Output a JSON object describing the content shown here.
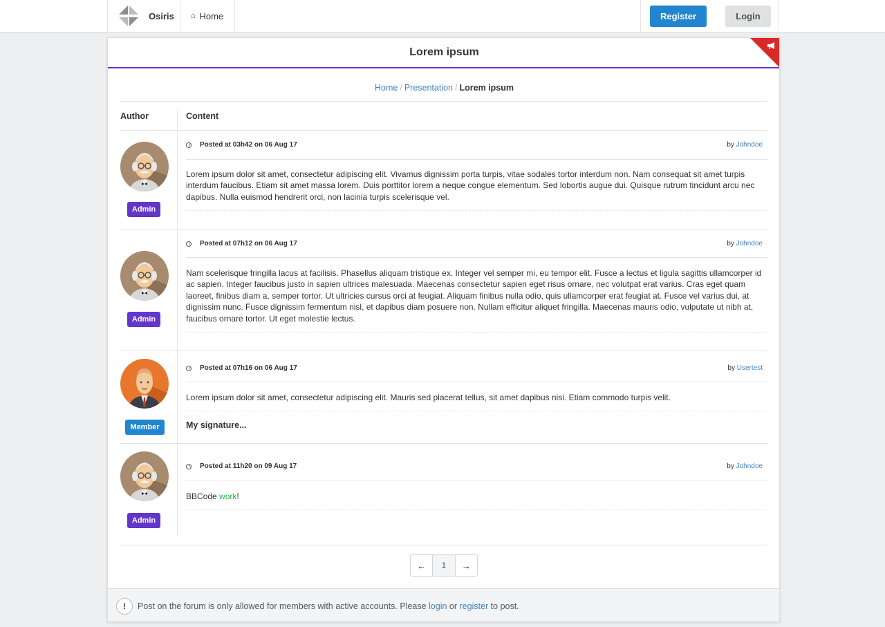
{
  "nav": {
    "brand": "Osiris",
    "home": "Home",
    "register": "Register",
    "login": "Login"
  },
  "page": {
    "title": "Lorem ipsum",
    "breadcrumb": [
      "Home",
      "Presentation",
      "Lorem ipsum"
    ]
  },
  "table": {
    "col_author": "Author",
    "col_content": "Content"
  },
  "posts": [
    {
      "meta": "Posted at 03h42 on 06 Aug 17",
      "by": "by",
      "user": "Johndoe",
      "role": "Admin",
      "text": "Lorem ipsum dolor sit amet, consectetur adipiscing elit. Vivamus dignissim porta turpis, vitae sodales tortor interdum non. Nam consequat sit amet turpis interdum faucibus. Etiam sit amet massa lorem. Duis porttitor lorem a neque congue elementum. Sed lobortis augue dui. Quisque rutrum tincidunt arcu nec dapibus. Nulla euismod hendrerit orci, non lacinia turpis scelerisque vel."
    },
    {
      "meta": "Posted at 07h12 on 06 Aug 17",
      "by": "by",
      "user": "Johndoe",
      "role": "Admin",
      "text": "Nam scelerisque fringilla lacus at facilisis. Phasellus aliquam tristique ex. Integer vel semper mi, eu tempor elit. Fusce a lectus et ligula sagittis ullamcorper id ac sapien. Integer faucibus justo in sapien ultrices malesuada. Maecenas consectetur sapien eget risus ornare, nec volutpat erat varius. Cras eget quam laoreet, finibus diam a, semper tortor. Ut ultricies cursus orci at feugiat. Aliquam finibus nulla odio, quis ullamcorper erat feugiat at. Fusce vel varius dui, at dignissim nunc. Fusce dignissim fermentum nisl, et dapibus diam posuere non. Nullam efficitur aliquet fringilla. Maecenas mauris odio, vulputate ut nibh at, faucibus ornare tortor. Ut eget molestie lectus."
    },
    {
      "meta": "Posted at 07h16 on 06 Aug 17",
      "by": "by",
      "user": "Usertest",
      "role": "Member",
      "text": "Lorem ipsum dolor sit amet, consectetur adipiscing elit. Mauris sed placerat tellus, sit amet dapibus nisi. Etiam commodo turpis velit.",
      "signature": "My signature..."
    },
    {
      "meta": "Posted at 11h20 on 09 Aug 17",
      "by": "by",
      "user": "Johndoe",
      "role": "Admin",
      "text_prefix": "BBCode ",
      "text_green": "work",
      "text_suffix": "!"
    }
  ],
  "pagination": {
    "current": "1"
  },
  "footer": {
    "icon": "!",
    "text_before": "Post on the forum is only allowed for members with active accounts. Please ",
    "login": "login",
    "or": " or ",
    "register": "register",
    "text_after": " to post."
  },
  "colors": {
    "admin": "#6435c9",
    "member": "#2185d0",
    "link": "#4183c4",
    "ribbon": "#db2828"
  }
}
